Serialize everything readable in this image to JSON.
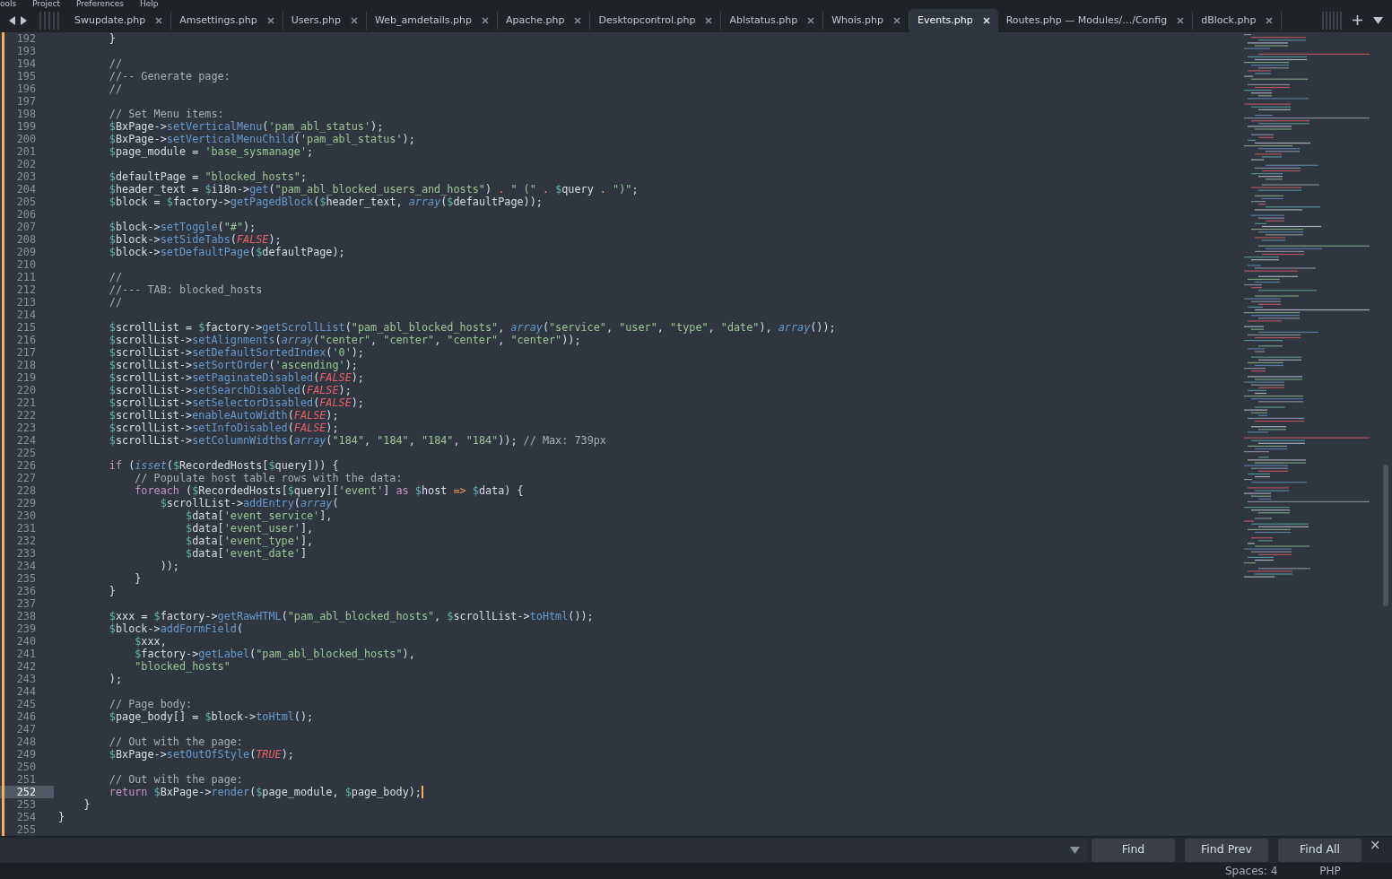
{
  "menu_bar": [
    "ools",
    "Project",
    "Preferences",
    "Help"
  ],
  "tabs": [
    {
      "label": "Swupdate.php",
      "selected": false
    },
    {
      "label": "Amsettings.php",
      "selected": false
    },
    {
      "label": "Users.php",
      "selected": false
    },
    {
      "label": "Web_amdetails.php",
      "selected": false
    },
    {
      "label": "Apache.php",
      "selected": false
    },
    {
      "label": "Desktopcontrol.php",
      "selected": false
    },
    {
      "label": "Ablstatus.php",
      "selected": false
    },
    {
      "label": "Whois.php",
      "selected": false
    },
    {
      "label": "Events.php",
      "selected": true
    },
    {
      "label": "Routes.php — Modules/…/Config",
      "selected": false
    },
    {
      "label": "dBlock.php",
      "selected": false
    }
  ],
  "editor": {
    "lines": [
      {
        "number": "192",
        "selected": false,
        "tokens": [
          {
            "kind": "plain",
            "text": "        }"
          }
        ]
      },
      {
        "number": "193",
        "selected": false
      },
      {
        "number": "194",
        "selected": false,
        "tokens": [
          {
            "kind": "comment",
            "text": "        //"
          }
        ]
      },
      {
        "number": "195",
        "selected": false,
        "tokens": [
          {
            "kind": "comment",
            "text": "        //-- Generate page:"
          }
        ]
      },
      {
        "number": "196",
        "selected": false,
        "tokens": [
          {
            "kind": "comment",
            "text": "        //"
          }
        ]
      },
      {
        "number": "197",
        "selected": false
      },
      {
        "number": "198",
        "selected": false,
        "tokens": [
          {
            "kind": "comment",
            "text": "        // Set Menu items:"
          }
        ]
      },
      {
        "number": "199",
        "selected": false,
        "tokens": [
          {
            "kind": "var",
            "text": "        $BxPage"
          },
          {
            "kind": "plain",
            "text": "->"
          },
          {
            "kind": "method",
            "text": "setVerticalMenu"
          },
          {
            "kind": "plain",
            "text": "("
          },
          {
            "kind": "string",
            "text": "'pam_abl_status'"
          },
          {
            "kind": "plain",
            "text": ");"
          }
        ]
      },
      {
        "number": "200",
        "selected": false,
        "tokens": [
          {
            "kind": "var",
            "text": "        $BxPage"
          },
          {
            "kind": "plain",
            "text": "->"
          },
          {
            "kind": "method",
            "text": "setVerticalMenuChild"
          },
          {
            "kind": "plain",
            "text": "("
          },
          {
            "kind": "string",
            "text": "'pam_abl_status'"
          },
          {
            "kind": "plain",
            "text": ");"
          }
        ]
      },
      {
        "number": "201",
        "selected": false,
        "tokens": [
          {
            "kind": "var",
            "text": "        $page_module"
          },
          {
            "kind": "plain",
            "text": " = "
          },
          {
            "kind": "string",
            "text": "'base_sysmanage'"
          },
          {
            "kind": "plain",
            "text": ";"
          }
        ]
      },
      {
        "number": "202",
        "selected": false
      },
      {
        "number": "203",
        "selected": false,
        "tokens": [
          {
            "kind": "var",
            "text": "        $defaultPage"
          },
          {
            "kind": "plain",
            "text": " = "
          },
          {
            "kind": "string",
            "text": "\"blocked_hosts\""
          },
          {
            "kind": "plain",
            "text": ";"
          }
        ]
      },
      {
        "number": "204",
        "selected": false,
        "tokens": [
          {
            "kind": "var",
            "text": "        $header_text"
          },
          {
            "kind": "plain",
            "text": " = "
          },
          {
            "kind": "var",
            "text": "$i18n"
          },
          {
            "kind": "plain",
            "text": "->"
          },
          {
            "kind": "method",
            "text": "get"
          },
          {
            "kind": "plain",
            "text": "("
          },
          {
            "kind": "string",
            "text": "\"pam_abl_blocked_users_and_hosts\""
          },
          {
            "kind": "plain",
            "text": ") "
          },
          {
            "kind": "operator",
            "text": ". "
          },
          {
            "kind": "string",
            "text": "\" (\""
          },
          {
            "kind": "operator",
            "text": " . "
          },
          {
            "kind": "var",
            "text": "$query"
          },
          {
            "kind": "operator",
            "text": " . "
          },
          {
            "kind": "string",
            "text": "\")\""
          },
          {
            "kind": "plain",
            "text": ";"
          }
        ]
      },
      {
        "number": "205",
        "selected": false,
        "tokens": [
          {
            "kind": "var",
            "text": "        $block"
          },
          {
            "kind": "plain",
            "text": " = "
          },
          {
            "kind": "var",
            "text": "$factory"
          },
          {
            "kind": "plain",
            "text": "->"
          },
          {
            "kind": "method",
            "text": "getPagedBlock"
          },
          {
            "kind": "plain",
            "text": "("
          },
          {
            "kind": "var",
            "text": "$header_text"
          },
          {
            "kind": "plain",
            "text": ", "
          },
          {
            "kind": "builtin",
            "text": "array"
          },
          {
            "kind": "plain",
            "text": "("
          },
          {
            "kind": "var",
            "text": "$defaultPage"
          },
          {
            "kind": "plain",
            "text": "));"
          }
        ]
      },
      {
        "number": "206",
        "selected": false
      },
      {
        "number": "207",
        "selected": false,
        "tokens": [
          {
            "kind": "var",
            "text": "        $block"
          },
          {
            "kind": "plain",
            "text": "->"
          },
          {
            "kind": "method",
            "text": "setToggle"
          },
          {
            "kind": "plain",
            "text": "("
          },
          {
            "kind": "string",
            "text": "\"#\""
          },
          {
            "kind": "plain",
            "text": ");"
          }
        ]
      },
      {
        "number": "208",
        "selected": false,
        "tokens": [
          {
            "kind": "var",
            "text": "        $block"
          },
          {
            "kind": "plain",
            "text": "->"
          },
          {
            "kind": "method",
            "text": "setSideTabs"
          },
          {
            "kind": "plain",
            "text": "("
          },
          {
            "kind": "constant",
            "text": "FALSE"
          },
          {
            "kind": "plain",
            "text": ");"
          }
        ]
      },
      {
        "number": "209",
        "selected": false,
        "tokens": [
          {
            "kind": "var",
            "text": "        $block"
          },
          {
            "kind": "plain",
            "text": "->"
          },
          {
            "kind": "method",
            "text": "setDefaultPage"
          },
          {
            "kind": "plain",
            "text": "("
          },
          {
            "kind": "var",
            "text": "$defaultPage"
          },
          {
            "kind": "plain",
            "text": ");"
          }
        ]
      },
      {
        "number": "210",
        "selected": false
      },
      {
        "number": "211",
        "selected": false,
        "tokens": [
          {
            "kind": "comment",
            "text": "        //"
          }
        ]
      },
      {
        "number": "212",
        "selected": false,
        "tokens": [
          {
            "kind": "comment",
            "text": "        //--- TAB: blocked_hosts"
          }
        ]
      },
      {
        "number": "213",
        "selected": false,
        "tokens": [
          {
            "kind": "comment",
            "text": "        //"
          }
        ]
      },
      {
        "number": "214",
        "selected": false
      },
      {
        "number": "215",
        "selected": false,
        "tokens": [
          {
            "kind": "var",
            "text": "        $scrollList"
          },
          {
            "kind": "plain",
            "text": " = "
          },
          {
            "kind": "var",
            "text": "$factory"
          },
          {
            "kind": "plain",
            "text": "->"
          },
          {
            "kind": "method",
            "text": "getScrollList"
          },
          {
            "kind": "plain",
            "text": "("
          },
          {
            "kind": "string",
            "text": "\"pam_abl_blocked_hosts\""
          },
          {
            "kind": "plain",
            "text": ", "
          },
          {
            "kind": "builtin",
            "text": "array"
          },
          {
            "kind": "plain",
            "text": "("
          },
          {
            "kind": "string",
            "text": "\"service\""
          },
          {
            "kind": "plain",
            "text": ", "
          },
          {
            "kind": "string",
            "text": "\"user\""
          },
          {
            "kind": "plain",
            "text": ", "
          },
          {
            "kind": "string",
            "text": "\"type\""
          },
          {
            "kind": "plain",
            "text": ", "
          },
          {
            "kind": "string",
            "text": "\"date\""
          },
          {
            "kind": "plain",
            "text": "), "
          },
          {
            "kind": "builtin",
            "text": "array"
          },
          {
            "kind": "plain",
            "text": "());"
          }
        ]
      },
      {
        "number": "216",
        "selected": false,
        "tokens": [
          {
            "kind": "var",
            "text": "        $scrollList"
          },
          {
            "kind": "plain",
            "text": "->"
          },
          {
            "kind": "method",
            "text": "setAlignments"
          },
          {
            "kind": "plain",
            "text": "("
          },
          {
            "kind": "builtin",
            "text": "array"
          },
          {
            "kind": "plain",
            "text": "("
          },
          {
            "kind": "string",
            "text": "\"center\""
          },
          {
            "kind": "plain",
            "text": ", "
          },
          {
            "kind": "string",
            "text": "\"center\""
          },
          {
            "kind": "plain",
            "text": ", "
          },
          {
            "kind": "string",
            "text": "\"center\""
          },
          {
            "kind": "plain",
            "text": ", "
          },
          {
            "kind": "string",
            "text": "\"center\""
          },
          {
            "kind": "plain",
            "text": "));"
          }
        ]
      },
      {
        "number": "217",
        "selected": false,
        "tokens": [
          {
            "kind": "var",
            "text": "        $scrollList"
          },
          {
            "kind": "plain",
            "text": "->"
          },
          {
            "kind": "method",
            "text": "setDefaultSortedIndex"
          },
          {
            "kind": "plain",
            "text": "("
          },
          {
            "kind": "string",
            "text": "'0'"
          },
          {
            "kind": "plain",
            "text": ");"
          }
        ]
      },
      {
        "number": "218",
        "selected": false,
        "tokens": [
          {
            "kind": "var",
            "text": "        $scrollList"
          },
          {
            "kind": "plain",
            "text": "->"
          },
          {
            "kind": "method",
            "text": "setSortOrder"
          },
          {
            "kind": "plain",
            "text": "("
          },
          {
            "kind": "string",
            "text": "'ascending'"
          },
          {
            "kind": "plain",
            "text": ");"
          }
        ]
      },
      {
        "number": "219",
        "selected": false,
        "tokens": [
          {
            "kind": "var",
            "text": "        $scrollList"
          },
          {
            "kind": "plain",
            "text": "->"
          },
          {
            "kind": "method",
            "text": "setPaginateDisabled"
          },
          {
            "kind": "plain",
            "text": "("
          },
          {
            "kind": "constant",
            "text": "FALSE"
          },
          {
            "kind": "plain",
            "text": ");"
          }
        ]
      },
      {
        "number": "220",
        "selected": false,
        "tokens": [
          {
            "kind": "var",
            "text": "        $scrollList"
          },
          {
            "kind": "plain",
            "text": "->"
          },
          {
            "kind": "method",
            "text": "setSearchDisabled"
          },
          {
            "kind": "plain",
            "text": "("
          },
          {
            "kind": "constant",
            "text": "FALSE"
          },
          {
            "kind": "plain",
            "text": ");"
          }
        ]
      },
      {
        "number": "221",
        "selected": false,
        "tokens": [
          {
            "kind": "var",
            "text": "        $scrollList"
          },
          {
            "kind": "plain",
            "text": "->"
          },
          {
            "kind": "method",
            "text": "setSelectorDisabled"
          },
          {
            "kind": "plain",
            "text": "("
          },
          {
            "kind": "constant",
            "text": "FALSE"
          },
          {
            "kind": "plain",
            "text": ");"
          }
        ]
      },
      {
        "number": "222",
        "selected": false,
        "tokens": [
          {
            "kind": "var",
            "text": "        $scrollList"
          },
          {
            "kind": "plain",
            "text": "->"
          },
          {
            "kind": "method",
            "text": "enableAutoWidth"
          },
          {
            "kind": "plain",
            "text": "("
          },
          {
            "kind": "constant",
            "text": "FALSE"
          },
          {
            "kind": "plain",
            "text": ");"
          }
        ]
      },
      {
        "number": "223",
        "selected": false,
        "tokens": [
          {
            "kind": "var",
            "text": "        $scrollList"
          },
          {
            "kind": "plain",
            "text": "->"
          },
          {
            "kind": "method",
            "text": "setInfoDisabled"
          },
          {
            "kind": "plain",
            "text": "("
          },
          {
            "kind": "constant",
            "text": "FALSE"
          },
          {
            "kind": "plain",
            "text": ");"
          }
        ]
      },
      {
        "number": "224",
        "selected": false,
        "tokens": [
          {
            "kind": "var",
            "text": "        $scrollList"
          },
          {
            "kind": "plain",
            "text": "->"
          },
          {
            "kind": "method",
            "text": "setColumnWidths"
          },
          {
            "kind": "plain",
            "text": "("
          },
          {
            "kind": "builtin",
            "text": "array"
          },
          {
            "kind": "plain",
            "text": "("
          },
          {
            "kind": "string",
            "text": "\"184\""
          },
          {
            "kind": "plain",
            "text": ", "
          },
          {
            "kind": "string",
            "text": "\"184\""
          },
          {
            "kind": "plain",
            "text": ", "
          },
          {
            "kind": "string",
            "text": "\"184\""
          },
          {
            "kind": "plain",
            "text": ", "
          },
          {
            "kind": "string",
            "text": "\"184\""
          },
          {
            "kind": "plain",
            "text": ")); "
          },
          {
            "kind": "comment",
            "text": "// Max: 739px"
          }
        ]
      },
      {
        "number": "225",
        "selected": false
      },
      {
        "number": "226",
        "selected": false,
        "tokens": [
          {
            "kind": "keyword",
            "text": "        if"
          },
          {
            "kind": "plain",
            "text": " ("
          },
          {
            "kind": "builtin",
            "text": "isset"
          },
          {
            "kind": "plain",
            "text": "("
          },
          {
            "kind": "var",
            "text": "$RecordedHosts"
          },
          {
            "kind": "plain",
            "text": "["
          },
          {
            "kind": "var",
            "text": "$query"
          },
          {
            "kind": "plain",
            "text": "])) {"
          }
        ]
      },
      {
        "number": "227",
        "selected": false,
        "tokens": [
          {
            "kind": "comment",
            "text": "            // Populate host table rows with the data:"
          }
        ]
      },
      {
        "number": "228",
        "selected": false,
        "tokens": [
          {
            "kind": "keyword",
            "text": "            foreach"
          },
          {
            "kind": "plain",
            "text": " ("
          },
          {
            "kind": "var",
            "text": "$RecordedHosts"
          },
          {
            "kind": "plain",
            "text": "["
          },
          {
            "kind": "var",
            "text": "$query"
          },
          {
            "kind": "plain",
            "text": "]["
          },
          {
            "kind": "string",
            "text": "'event'"
          },
          {
            "kind": "plain",
            "text": "] "
          },
          {
            "kind": "keyword",
            "text": "as"
          },
          {
            "kind": "var",
            "text": " $host"
          },
          {
            "kind": "operator",
            "text": " => "
          },
          {
            "kind": "var",
            "text": "$data"
          },
          {
            "kind": "plain",
            "text": ") {"
          }
        ]
      },
      {
        "number": "229",
        "selected": false,
        "tokens": [
          {
            "kind": "var",
            "text": "                $scrollList"
          },
          {
            "kind": "plain",
            "text": "->"
          },
          {
            "kind": "method",
            "text": "addEntry"
          },
          {
            "kind": "plain",
            "text": "("
          },
          {
            "kind": "builtin",
            "text": "array"
          },
          {
            "kind": "plain",
            "text": "("
          }
        ]
      },
      {
        "number": "230",
        "selected": false,
        "tokens": [
          {
            "kind": "var",
            "text": "                    $data"
          },
          {
            "kind": "plain",
            "text": "["
          },
          {
            "kind": "string",
            "text": "'event_service'"
          },
          {
            "kind": "plain",
            "text": "],"
          }
        ]
      },
      {
        "number": "231",
        "selected": false,
        "tokens": [
          {
            "kind": "var",
            "text": "                    $data"
          },
          {
            "kind": "plain",
            "text": "["
          },
          {
            "kind": "string",
            "text": "'event_user'"
          },
          {
            "kind": "plain",
            "text": "],"
          }
        ]
      },
      {
        "number": "232",
        "selected": false,
        "tokens": [
          {
            "kind": "var",
            "text": "                    $data"
          },
          {
            "kind": "plain",
            "text": "["
          },
          {
            "kind": "string",
            "text": "'event_type'"
          },
          {
            "kind": "plain",
            "text": "],"
          }
        ]
      },
      {
        "number": "233",
        "selected": false,
        "tokens": [
          {
            "kind": "var",
            "text": "                    $data"
          },
          {
            "kind": "plain",
            "text": "["
          },
          {
            "kind": "string",
            "text": "'event_date'"
          },
          {
            "kind": "plain",
            "text": "]"
          }
        ]
      },
      {
        "number": "234",
        "selected": false,
        "tokens": [
          {
            "kind": "plain",
            "text": "                ));"
          }
        ]
      },
      {
        "number": "235",
        "selected": false,
        "tokens": [
          {
            "kind": "plain",
            "text": "            }"
          }
        ]
      },
      {
        "number": "236",
        "selected": false,
        "tokens": [
          {
            "kind": "plain",
            "text": "        }"
          }
        ]
      },
      {
        "number": "237",
        "selected": false
      },
      {
        "number": "238",
        "selected": false,
        "tokens": [
          {
            "kind": "var",
            "text": "        $xxx"
          },
          {
            "kind": "plain",
            "text": " = "
          },
          {
            "kind": "var",
            "text": "$factory"
          },
          {
            "kind": "plain",
            "text": "->"
          },
          {
            "kind": "method",
            "text": "getRawHTML"
          },
          {
            "kind": "plain",
            "text": "("
          },
          {
            "kind": "string",
            "text": "\"pam_abl_blocked_hosts\""
          },
          {
            "kind": "plain",
            "text": ", "
          },
          {
            "kind": "var",
            "text": "$scrollList"
          },
          {
            "kind": "plain",
            "text": "->"
          },
          {
            "kind": "method",
            "text": "toHtml"
          },
          {
            "kind": "plain",
            "text": "());"
          }
        ]
      },
      {
        "number": "239",
        "selected": false,
        "tokens": [
          {
            "kind": "var",
            "text": "        $block"
          },
          {
            "kind": "plain",
            "text": "->"
          },
          {
            "kind": "method",
            "text": "addFormField"
          },
          {
            "kind": "plain",
            "text": "("
          }
        ]
      },
      {
        "number": "240",
        "selected": false,
        "tokens": [
          {
            "kind": "var",
            "text": "            $xxx"
          },
          {
            "kind": "plain",
            "text": ","
          }
        ]
      },
      {
        "number": "241",
        "selected": false,
        "tokens": [
          {
            "kind": "var",
            "text": "            $factory"
          },
          {
            "kind": "plain",
            "text": "->"
          },
          {
            "kind": "method",
            "text": "getLabel"
          },
          {
            "kind": "plain",
            "text": "("
          },
          {
            "kind": "string",
            "text": "\"pam_abl_blocked_hosts\""
          },
          {
            "kind": "plain",
            "text": "),"
          }
        ]
      },
      {
        "number": "242",
        "selected": false,
        "tokens": [
          {
            "kind": "string",
            "text": "            \"blocked_hosts\""
          }
        ]
      },
      {
        "number": "243",
        "selected": false,
        "tokens": [
          {
            "kind": "plain",
            "text": "        );"
          }
        ]
      },
      {
        "number": "244",
        "selected": false
      },
      {
        "number": "245",
        "selected": false,
        "tokens": [
          {
            "kind": "comment",
            "text": "        // Page body:"
          }
        ]
      },
      {
        "number": "246",
        "selected": false,
        "tokens": [
          {
            "kind": "var",
            "text": "        $page_body"
          },
          {
            "kind": "plain",
            "text": "[] = "
          },
          {
            "kind": "var",
            "text": "$block"
          },
          {
            "kind": "plain",
            "text": "->"
          },
          {
            "kind": "method",
            "text": "toHtml"
          },
          {
            "kind": "plain",
            "text": "();"
          }
        ]
      },
      {
        "number": "247",
        "selected": false
      },
      {
        "number": "248",
        "selected": false,
        "tokens": [
          {
            "kind": "comment",
            "text": "        // Out with the page:"
          }
        ]
      },
      {
        "number": "249",
        "selected": false,
        "tokens": [
          {
            "kind": "var",
            "text": "        $BxPage"
          },
          {
            "kind": "plain",
            "text": "->"
          },
          {
            "kind": "method",
            "text": "setOutOfStyle"
          },
          {
            "kind": "plain",
            "text": "("
          },
          {
            "kind": "constant",
            "text": "TRUE"
          },
          {
            "kind": "plain",
            "text": ");"
          }
        ]
      },
      {
        "number": "250",
        "selected": false
      },
      {
        "number": "251",
        "selected": false,
        "tokens": [
          {
            "kind": "comment",
            "text": "        // Out with the page:"
          }
        ]
      },
      {
        "number": "252",
        "selected": true,
        "tokens": [
          {
            "kind": "keyword",
            "text": "        return"
          },
          {
            "kind": "var",
            "text": " $BxPage"
          },
          {
            "kind": "plain",
            "text": "->"
          },
          {
            "kind": "method",
            "text": "render"
          },
          {
            "kind": "plain",
            "text": "("
          },
          {
            "kind": "var",
            "text": "$page_module"
          },
          {
            "kind": "plain",
            "text": ", "
          },
          {
            "kind": "var",
            "text": "$page_body"
          },
          {
            "kind": "plain",
            "text": ");"
          }
        ]
      },
      {
        "number": "253",
        "selected": false,
        "tokens": [
          {
            "kind": "plain",
            "text": "    }"
          }
        ]
      },
      {
        "number": "254",
        "selected": false,
        "tokens": [
          {
            "kind": "plain",
            "text": "}"
          }
        ]
      },
      {
        "number": "255",
        "selected": false
      }
    ]
  },
  "find_panel": {
    "buttons": [
      "Find",
      "Find Prev",
      "Find All"
    ],
    "close": "×"
  },
  "status_bar": {
    "indentation": "Spaces: 4",
    "syntax": "PHP"
  }
}
